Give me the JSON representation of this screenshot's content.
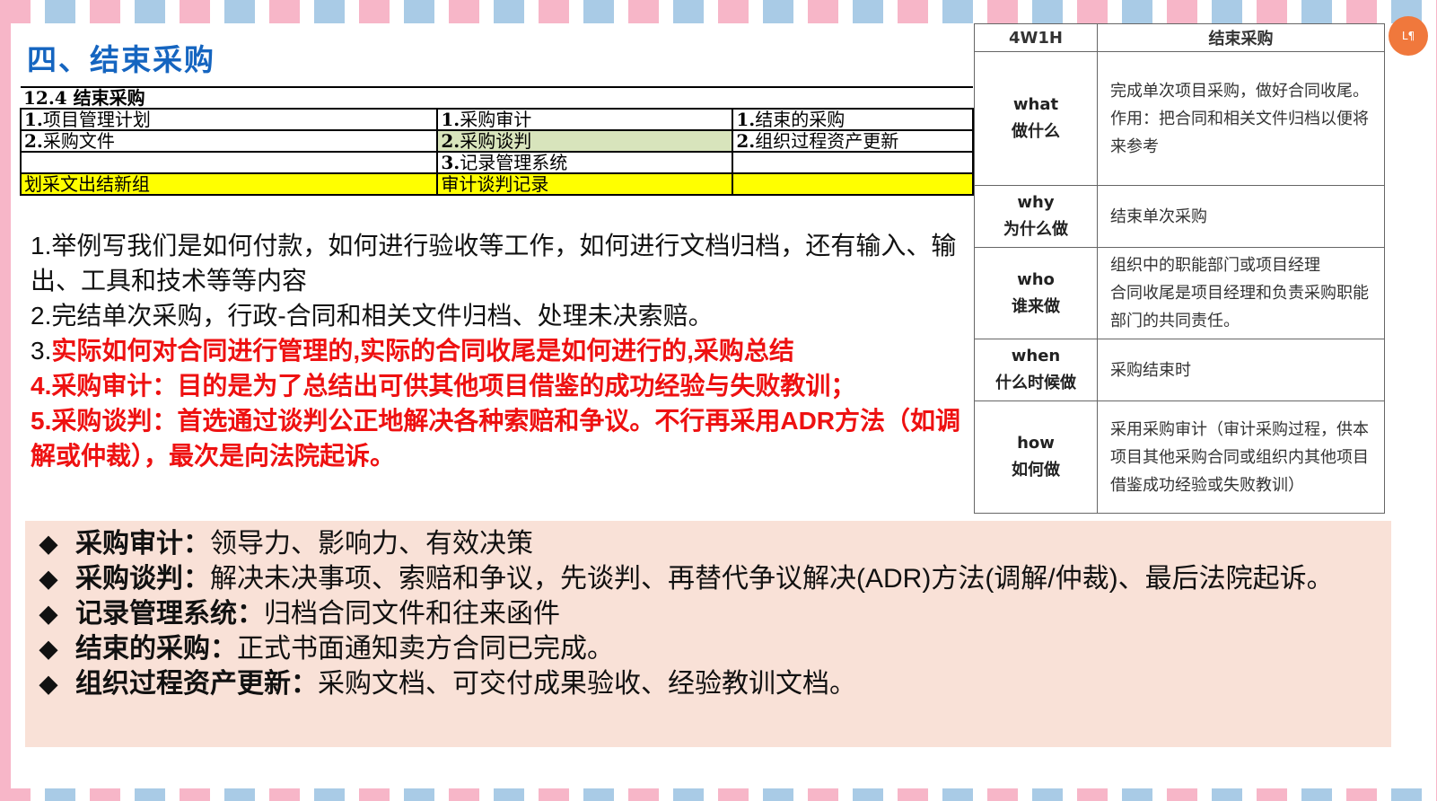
{
  "slide": {
    "title": "四、结束采购",
    "corner_badge": "L¶"
  },
  "itto_table": {
    "header": "12.4 结束采购",
    "rows": [
      [
        {
          "num": "1.",
          "text": "项目管理计划"
        },
        {
          "num": "1.",
          "text": "采购审计"
        },
        {
          "num": "1.",
          "text": "结束的采购"
        }
      ],
      [
        {
          "num": "2.",
          "text": "采购文件"
        },
        {
          "num": "2.",
          "text": "采购谈判"
        },
        {
          "num": "2.",
          "text": "组织过程资产更新"
        }
      ],
      [
        {
          "num": "",
          "text": ""
        },
        {
          "num": "3.",
          "text": "记录管理系统"
        },
        {
          "num": "",
          "text": ""
        }
      ],
      [
        {
          "num": "",
          "text": "划采文出结新组"
        },
        {
          "num": "",
          "text": "审计谈判记录"
        },
        {
          "num": "",
          "text": ""
        }
      ]
    ]
  },
  "notes": [
    {
      "prefix": "1.",
      "text": "举例写我们是如何付款，如何进行验收等工作，如何进行文档归档，还有输入、输出、工具和技术等等内容"
    },
    {
      "prefix": "2.",
      "text": "完结单次采购，行政-合同和相关文件归档、处理未决索赔。"
    },
    {
      "prefix": "3.",
      "text": "实际如何对合同进行管理的,实际的合同收尾是如何进行的,采购总结"
    },
    {
      "prefix": "4.",
      "text": "采购审计：目的是为了总结出可供其他项目借鉴的成功经验与失败教训；"
    },
    {
      "prefix": "5.",
      "text": "采购谈判：首选通过谈判公正地解决各种索赔和争议。不行再采用ADR方法（如调解或仲裁），最次是向法院起诉。"
    }
  ],
  "w4h_table": {
    "header_left": "4W1H",
    "header_right": "结束采购",
    "rows": [
      {
        "en": "what",
        "cn": "做什么",
        "value": "完成单次项目采购，做好合同收尾。\n作用：把合同和相关文件归档以便将来参考"
      },
      {
        "en": "why",
        "cn": "为什么做",
        "value": "结束单次采购"
      },
      {
        "en": "who",
        "cn": "谁来做",
        "value": "组织中的职能部门或项目经理\n合同收尾是项目经理和负责采购职能部门的共同责任。"
      },
      {
        "en": "when",
        "cn": "什么时候做",
        "value": "采购结束时"
      },
      {
        "en": "how",
        "cn": "如何做",
        "value": "采用采购审计（审计采购过程，供本项目其他采购合同或组织内其他项目借鉴成功经验或失败教训）"
      }
    ]
  },
  "summary": [
    {
      "term": "采购审计：",
      "desc": "领导力、影响力、有效决策"
    },
    {
      "term": "采购谈判：",
      "desc": "解决未决事项、索赔和争议，先谈判、再替代争议解决(ADR)方法(调解/仲裁)、最后法院起诉。"
    },
    {
      "term": "记录管理系统：",
      "desc": "归档合同文件和往来函件"
    },
    {
      "term": "结束的采购：",
      "desc": "正式书面通知卖方合同已完成。"
    },
    {
      "term": "组织过程资产更新：",
      "desc": "采购文档、可交付成果验收、经验教训文档。"
    }
  ]
}
